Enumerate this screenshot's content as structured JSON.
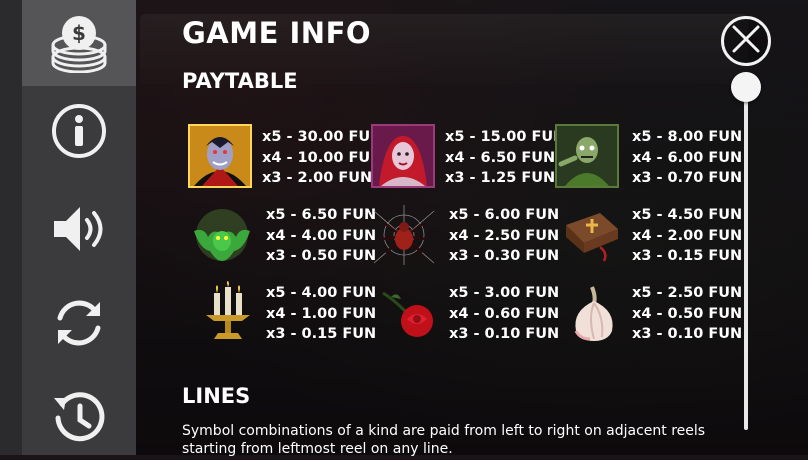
{
  "header": {
    "title": "GAME INFO"
  },
  "sidebar": {
    "items": [
      {
        "icon": "coins-stack-icon"
      },
      {
        "icon": "info-icon"
      },
      {
        "icon": "sound-icon"
      },
      {
        "icon": "autoplay-icon"
      },
      {
        "icon": "history-icon"
      }
    ]
  },
  "paytable": {
    "heading": "PAYTABLE",
    "symbols": [
      {
        "icon": "vampire-icon",
        "x5": "x5 - 30.00 FUN",
        "x4": "x4 - 10.00 FUN",
        "x3": "x3 - 2.00 FUN"
      },
      {
        "icon": "vampire-woman-icon",
        "x5": "x5 - 15.00 FUN",
        "x4": "x4 - 6.50 FUN",
        "x3": "x3 - 1.25 FUN"
      },
      {
        "icon": "zombie-icon",
        "x5": "x5 - 8.00 FUN",
        "x4": "x4 - 6.00 FUN",
        "x3": "x3 - 0.70 FUN"
      },
      {
        "icon": "bat-icon",
        "x5": "x5 - 6.50 FUN",
        "x4": "x4 - 4.00 FUN",
        "x3": "x3 - 0.50 FUN"
      },
      {
        "icon": "spider-icon",
        "x5": "x5 - 6.00 FUN",
        "x4": "x4 - 2.50 FUN",
        "x3": "x3 - 0.30 FUN"
      },
      {
        "icon": "bible-icon",
        "x5": "x5 - 4.50 FUN",
        "x4": "x4 - 2.00 FUN",
        "x3": "x3 - 0.15 FUN"
      },
      {
        "icon": "candles-icon",
        "x5": "x5 - 4.00 FUN",
        "x4": "x4 - 1.00 FUN",
        "x3": "x3 - 0.15 FUN"
      },
      {
        "icon": "rose-icon",
        "x5": "x5 - 3.00 FUN",
        "x4": "x4 - 0.60 FUN",
        "x3": "x3 - 0.10 FUN"
      },
      {
        "icon": "garlic-icon",
        "x5": "x5 - 2.50 FUN",
        "x4": "x4 - 0.50 FUN",
        "x3": "x3 - 0.10 FUN"
      }
    ]
  },
  "lines": {
    "heading": "LINES",
    "text": "Symbol combinations of a kind are paid from left to right on adjacent reels starting from leftmost reel on any line."
  },
  "colors": {
    "sidebar": "#3b3b3d",
    "sidebar_active": "#555557",
    "text": "#ffffff"
  }
}
